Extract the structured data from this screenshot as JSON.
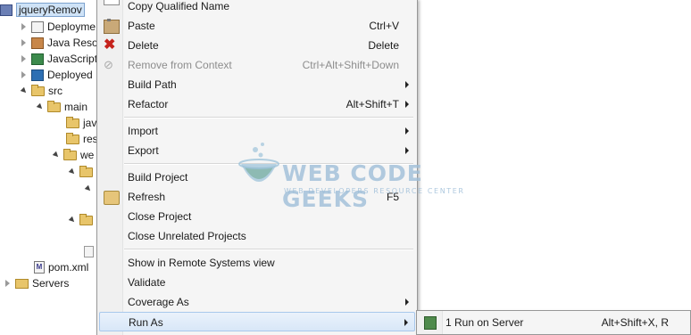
{
  "tree": {
    "items": [
      {
        "label": "jqueryRemov",
        "icon": "project-icon"
      },
      {
        "label": "Deployme",
        "icon": "deployment-descriptor-icon"
      },
      {
        "label": "Java Reso",
        "icon": "java-resources-icon"
      },
      {
        "label": "JavaScript",
        "icon": "javascript-resources-icon"
      },
      {
        "label": "Deployed",
        "icon": "deployed-resources-icon"
      },
      {
        "label": "src",
        "icon": "folder-icon"
      },
      {
        "label": "main",
        "icon": "folder-icon"
      },
      {
        "label": "jav",
        "icon": "folder-icon"
      },
      {
        "label": "res",
        "icon": "folder-icon"
      },
      {
        "label": "we",
        "icon": "folder-icon"
      },
      {
        "label": "pom.xml",
        "icon": "maven-pom-icon"
      },
      {
        "label": "Servers",
        "icon": "folder-icon"
      }
    ]
  },
  "menu": {
    "items": [
      {
        "label": "Copy Qualified Name",
        "shortcut": ""
      },
      {
        "label": "Paste",
        "shortcut": "Ctrl+V"
      },
      {
        "label": "Delete",
        "shortcut": "Delete"
      },
      {
        "label": "Remove from Context",
        "shortcut": "Ctrl+Alt+Shift+Down"
      },
      {
        "label": "Build Path",
        "shortcut": ""
      },
      {
        "label": "Refactor",
        "shortcut": "Alt+Shift+T"
      },
      {
        "label": "Import",
        "shortcut": ""
      },
      {
        "label": "Export",
        "shortcut": ""
      },
      {
        "label": "Build Project",
        "shortcut": ""
      },
      {
        "label": "Refresh",
        "shortcut": "F5"
      },
      {
        "label": "Close Project",
        "shortcut": ""
      },
      {
        "label": "Close Unrelated Projects",
        "shortcut": ""
      },
      {
        "label": "Show in Remote Systems view",
        "shortcut": ""
      },
      {
        "label": "Validate",
        "shortcut": ""
      },
      {
        "label": "Coverage As",
        "shortcut": ""
      },
      {
        "label": "Run As",
        "shortcut": ""
      }
    ]
  },
  "submenu": {
    "items": [
      {
        "label": "1 Run on Server",
        "shortcut": "Alt+Shift+X, R"
      }
    ]
  },
  "watermark": {
    "title": "WEB CODE GEEKS",
    "subtitle": "WEB DEVELOPERS RESOURCE CENTER"
  },
  "colors": {
    "menu_bg": "#f5f5f5",
    "highlight": "#d8e7f8",
    "disabled_text": "#8d8d8d",
    "delete_icon": "#c5231c"
  }
}
